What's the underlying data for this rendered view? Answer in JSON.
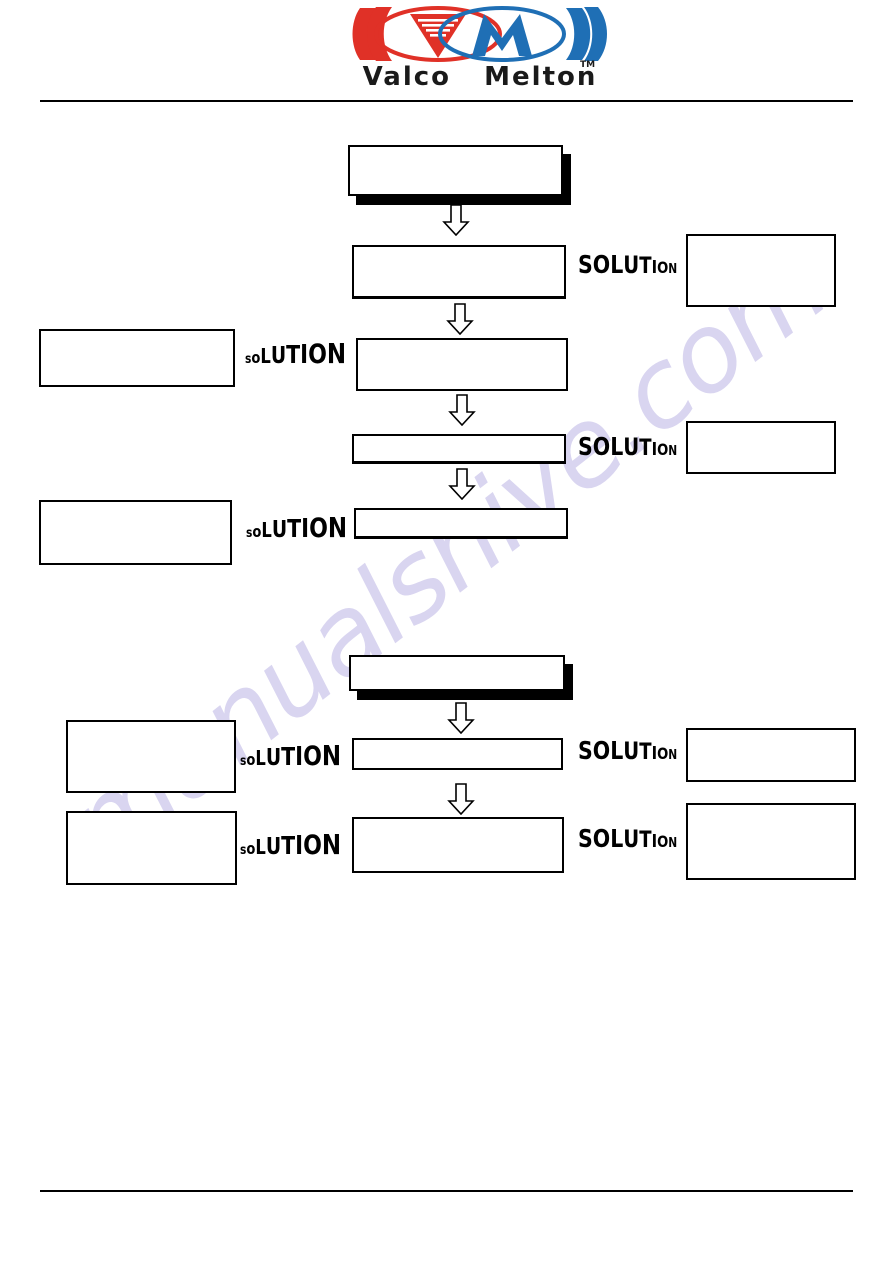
{
  "document": {
    "brand": {
      "name_part1": "Valco",
      "name_part2": "Melton",
      "trademark": "TM",
      "logo_red": "#e03127",
      "logo_blue": "#1f6fb5",
      "logo_icon": "valco-melton-logo"
    },
    "watermark": {
      "text": "manualshive.com",
      "color": "#d9d5f0"
    },
    "rules": {
      "top": "header-rule",
      "bottom": "footer-rule"
    }
  },
  "solution_label": "SOLUTION",
  "flow_top": {
    "title_box": {
      "text": ""
    },
    "steps": [
      {
        "text": ""
      },
      {
        "text": ""
      },
      {
        "text": ""
      },
      {
        "text": ""
      }
    ],
    "left_solutions": [
      {
        "text": ""
      },
      {
        "text": ""
      }
    ],
    "right_solutions": [
      {
        "text": ""
      },
      {
        "text": ""
      }
    ],
    "arrows": 4
  },
  "flow_bottom": {
    "title_box": {
      "text": ""
    },
    "steps": [
      {
        "text": ""
      },
      {
        "text": ""
      }
    ],
    "left_solutions": [
      {
        "text": ""
      },
      {
        "text": ""
      }
    ],
    "right_solutions": [
      {
        "text": ""
      },
      {
        "text": ""
      }
    ],
    "arrows": 2
  }
}
